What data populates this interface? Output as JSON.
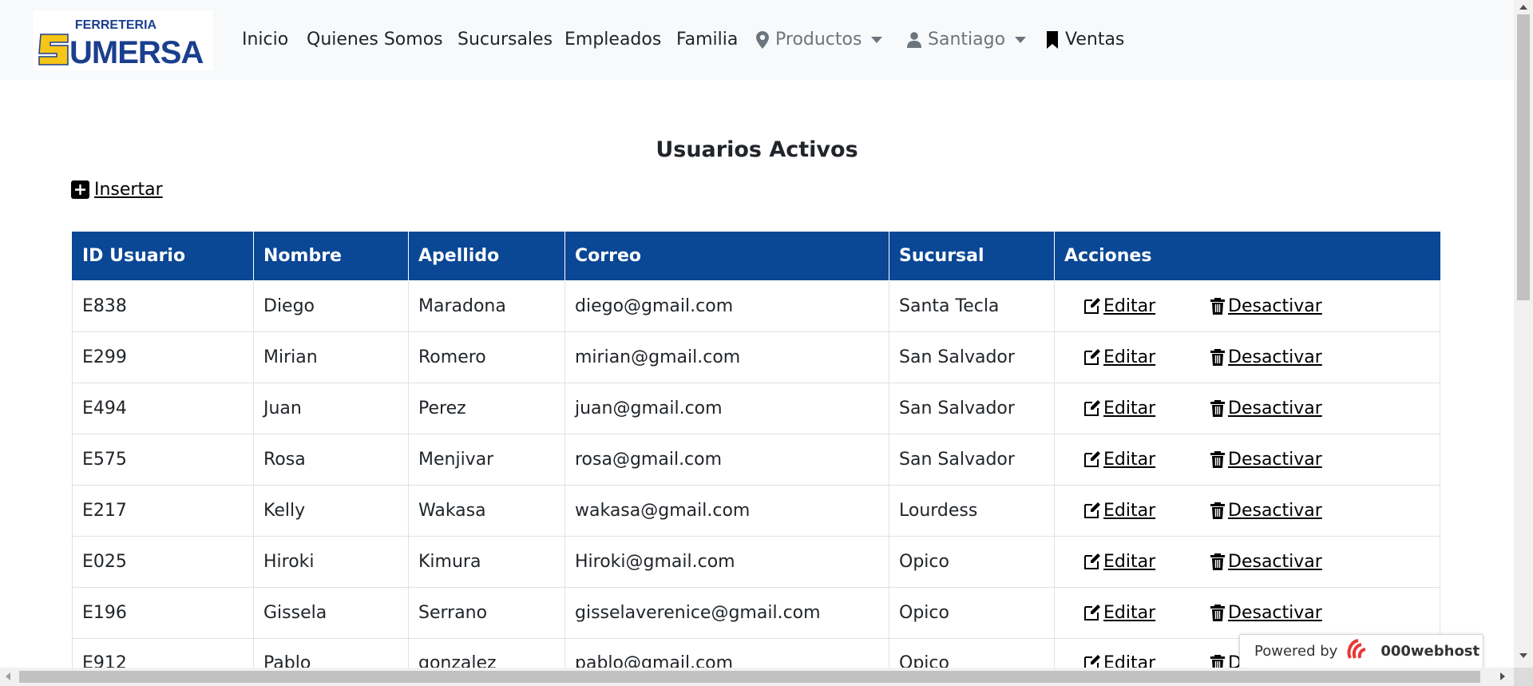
{
  "brand": {
    "logo_text_top": "FERRETERIA",
    "logo_text_main": "SUMERSA"
  },
  "nav": {
    "items": [
      "Inicio",
      "Quienes Somos",
      "Sucursales",
      "Empleados",
      "Familia"
    ],
    "productos": "Productos",
    "user": "Santiago",
    "ventas": "Ventas"
  },
  "page": {
    "title": "Usuarios Activos",
    "insert_label": " Insertar"
  },
  "table": {
    "headers": [
      "ID Usuario",
      "Nombre",
      "Apellido",
      "Correo",
      "Sucursal",
      "Acciones"
    ],
    "edit_label": " Editar ",
    "deactivate_label": " Desactivar",
    "rows": [
      [
        "E838",
        "Diego",
        "Maradona",
        "diego@gmail.com",
        "Santa Tecla"
      ],
      [
        "E299",
        "Mirian",
        "Romero",
        "mirian@gmail.com",
        "San Salvador"
      ],
      [
        "E494",
        "Juan",
        "Perez",
        "juan@gmail.com",
        "San Salvador"
      ],
      [
        "E575",
        "Rosa",
        "Menjivar",
        "rosa@gmail.com",
        "San Salvador"
      ],
      [
        "E217",
        "Kelly",
        "Wakasa",
        "wakasa@gmail.com",
        "Lourdess"
      ],
      [
        "E025",
        "Hiroki",
        "Kimura",
        "Hiroki@gmail.com",
        "Opico"
      ],
      [
        "E196",
        "Gissela",
        "Serrano",
        "gisselaverenice@gmail.com",
        "Opico"
      ],
      [
        "E912",
        "Pablo",
        "gonzalez",
        "pablo@gmail.com",
        "Opico"
      ]
    ]
  },
  "watermark": {
    "powered_by": "Powered by",
    "host": "000webhost"
  },
  "colors": {
    "header_bg": "#0a4795",
    "navbar_bg": "#f8f9fa",
    "logo_yellow": "#f5c518",
    "logo_blue": "#1b3f8f"
  }
}
